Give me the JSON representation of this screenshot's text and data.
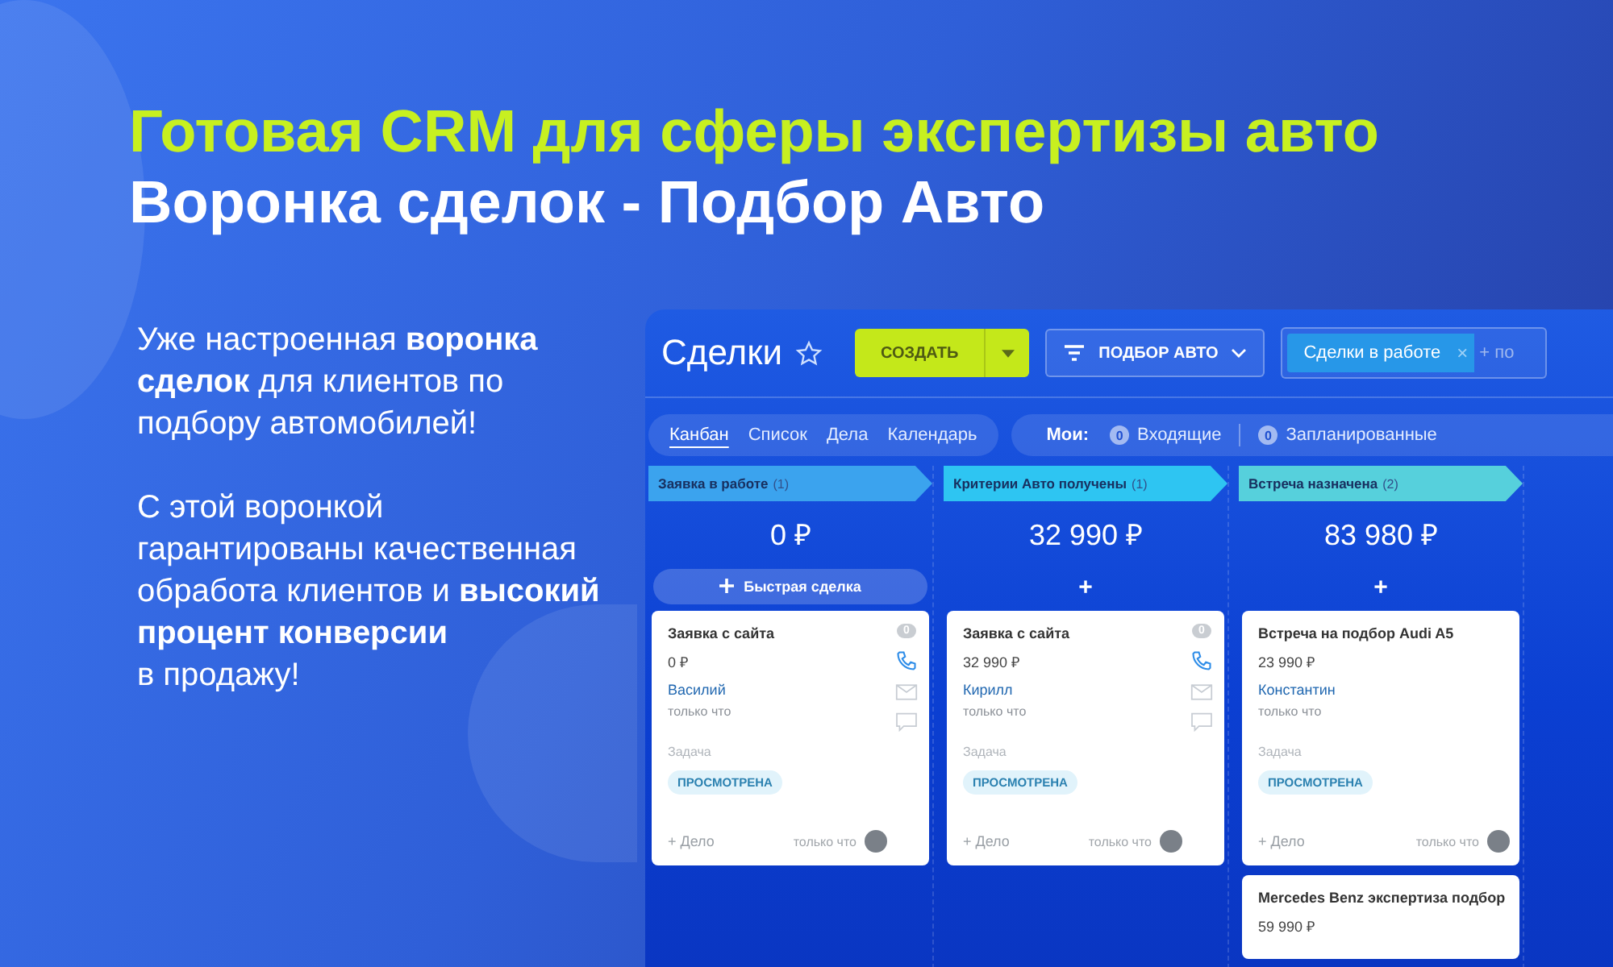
{
  "headline": {
    "accent": "Готовая CRM для сферы экспертизы авто",
    "title": "Воронка сделок - Подбор Авто"
  },
  "paragraphs": [
    "Уже настроенная **воронка**\n**сделок** для клиентов по\nподбору автомобилей!",
    "С этой воронкой\nгарантированы качественная\nобработа клиентов и **высокий**\n**процент конверсии**\nв продажу!"
  ],
  "crm": {
    "title": "Сделки",
    "create_button": "СОЗДАТЬ",
    "filter_button": "ПОДБОР АВТО",
    "search": {
      "chip": "Сделки в работе",
      "chip_close": "×",
      "placeholder": "+ по"
    },
    "views": [
      {
        "label": "Канбан",
        "selected": true
      },
      {
        "label": "Список",
        "selected": false
      },
      {
        "label": "Дела",
        "selected": false
      },
      {
        "label": "Календарь",
        "selected": false
      }
    ],
    "mine": {
      "label": "Мои:",
      "counters": [
        {
          "count": "0",
          "label": "Входящие"
        },
        {
          "count": "0",
          "label": "Запланированные"
        }
      ]
    },
    "columns": [
      {
        "name": "Заявка в работе",
        "count": "(1)",
        "color": "#3ba3ee",
        "sum": "0 ₽",
        "quick_add": "Быстрая сделка",
        "cards": [
          {
            "title": "Заявка с сайта",
            "amount": "0 ₽",
            "contact": "Василий",
            "time": "только что",
            "task_label": "Задача",
            "status": "ПРОСМОТРЕНА",
            "add": "+ Дело",
            "footer_time": "только что",
            "counter": "0"
          }
        ]
      },
      {
        "name": "Критерии Авто получены",
        "count": "(1)",
        "color": "#2ec5f2",
        "sum": "32 990 ₽",
        "quick_add": "+",
        "cards": [
          {
            "title": "Заявка с сайта",
            "amount": "32 990 ₽",
            "contact": "Кирилл",
            "time": "только что",
            "task_label": "Задача",
            "status": "ПРОСМОТРЕНА",
            "add": "+ Дело",
            "footer_time": "только что",
            "counter": "0"
          }
        ]
      },
      {
        "name": "Встреча назначена",
        "count": "(2)",
        "color": "#56d0dc",
        "sum": "83 980 ₽",
        "quick_add": "+",
        "cards": [
          {
            "title": "Встреча на подбор Audi A5",
            "amount": "23 990 ₽",
            "contact": "Константин",
            "time": "только что",
            "task_label": "Задача",
            "status": "ПРОСМОТРЕНА",
            "add": "+ Дело",
            "footer_time": "только что"
          },
          {
            "title": "Mercedes Benz экспертиза подбор",
            "amount": "59 990 ₽"
          }
        ]
      }
    ]
  }
}
